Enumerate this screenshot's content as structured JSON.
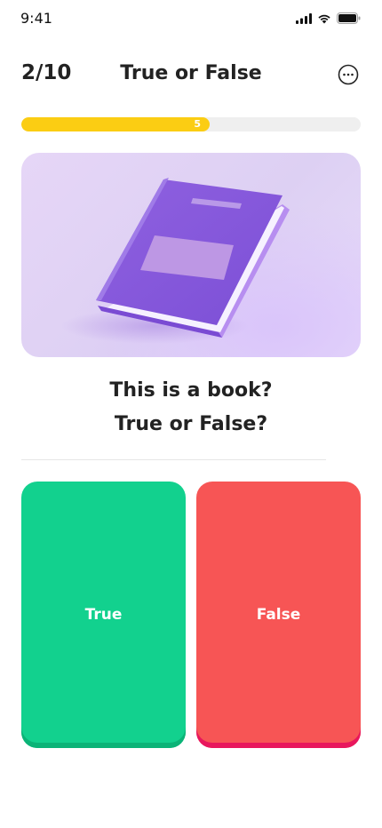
{
  "status_bar": {
    "time": "9:41",
    "icons": [
      "cellular-signal-icon",
      "wifi-icon",
      "battery-icon"
    ]
  },
  "header": {
    "counter": "2/10",
    "title": "True or False",
    "more_icon": "more-options-icon"
  },
  "progress": {
    "label": "5",
    "fraction": 0.555,
    "fill_color": "#fbcd13",
    "track_color": "#efefef"
  },
  "image": {
    "subject": "book-illustration",
    "background_color": "#e2d4f6",
    "book_color": "#8e5ee0"
  },
  "question": {
    "line1": "This is a book?",
    "line2": "True or False?"
  },
  "answers": {
    "true_label": "True",
    "false_label": "False",
    "true_color": "#12d18e",
    "false_color": "#f75555"
  }
}
